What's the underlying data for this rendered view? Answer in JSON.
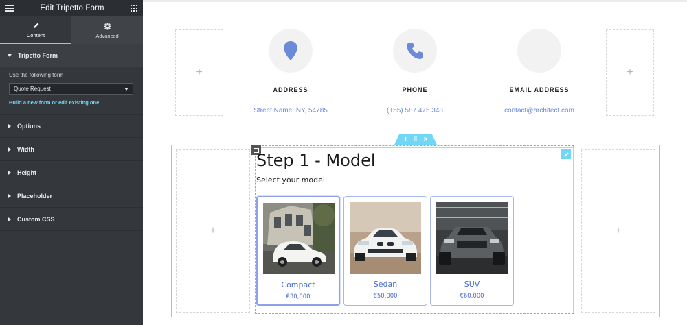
{
  "sidebar": {
    "title": "Edit Tripetto Form",
    "tabs": [
      {
        "label": "Content",
        "icon": "pencil-icon"
      },
      {
        "label": "Advanced",
        "icon": "gear-icon"
      }
    ],
    "tripetto_section": {
      "title": "Tripetto Form",
      "form_label": "Use the following form",
      "selected_form": "Quote Request",
      "link": "Build a new form or edit existing one"
    },
    "sections": [
      "Options",
      "Width",
      "Height",
      "Placeholder",
      "Custom CSS"
    ],
    "accent_color": "#71d7f7"
  },
  "contact": [
    {
      "label": "ADDRESS",
      "value": "Street Name, NY, 54785",
      "icon": "location-pin-icon"
    },
    {
      "label": "PHONE",
      "value": "(+55) 587 475 348",
      "icon": "phone-icon"
    },
    {
      "label": "EMAIL ADDRESS",
      "value": "contact@architect.com",
      "icon": ""
    }
  ],
  "add_symbol": "+",
  "form": {
    "title": "Step 1 - Model",
    "description": "Select your model.",
    "options": [
      {
        "name": "Compact",
        "price": "€30,000",
        "selected": true
      },
      {
        "name": "Sedan",
        "price": "€50,000",
        "selected": false
      },
      {
        "name": "SUV",
        "price": "€60,000",
        "selected": false
      }
    ],
    "accent_color": "#4a6bd0"
  }
}
